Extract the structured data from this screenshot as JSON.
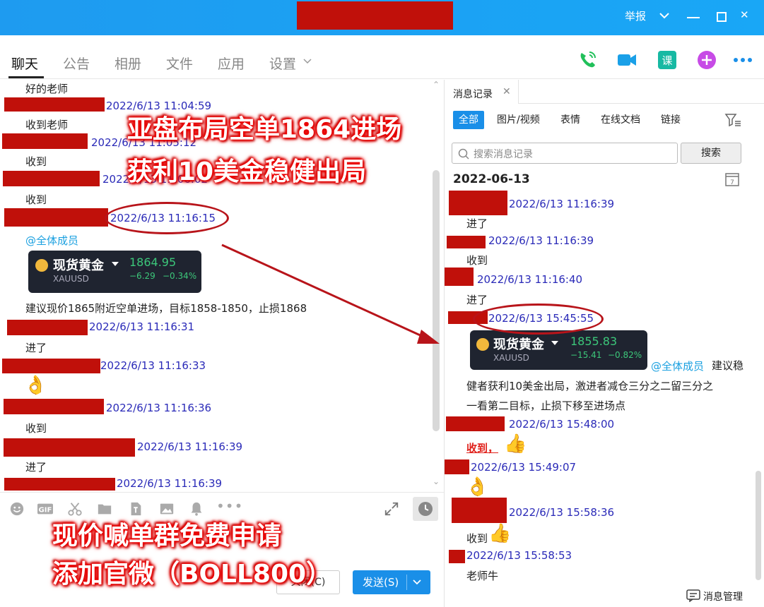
{
  "titlebar": {
    "report": "举报",
    "close": "✕"
  },
  "nav": {
    "tabs": [
      "聊天",
      "公告",
      "相册",
      "文件",
      "应用",
      "设置"
    ]
  },
  "left": {
    "messages": [
      {
        "text": "好的老师"
      },
      {
        "ts": "2022/6/13 11:04:59",
        "text": "收到老师"
      },
      {
        "ts": "2022/6/13 11:05:12",
        "text": "收到"
      },
      {
        "ts": "2022/6/13 11:06:02",
        "text": "收到"
      },
      {
        "ts": "2022/6/13 11:16:15",
        "mention": "@全体成员"
      },
      {
        "advice": "建议现价1865附近空单进场，目标1858-1850，止损1868"
      },
      {
        "ts": "2022/6/13 11:16:31",
        "text": "进了"
      },
      {
        "ts": "2022/6/13 11:16:33",
        "text": ""
      },
      {
        "ts": "2022/6/13 11:16:36",
        "text": "收到"
      },
      {
        "ts": "2022/6/13 11:16:39",
        "text": "进了"
      },
      {
        "ts": "2022/6/13 11:16:39"
      }
    ],
    "stock": {
      "name": "现货黄金",
      "code": "XAUUSD",
      "price": "1864.95",
      "chg": "−6.29",
      "pct": "−0.34%"
    },
    "close_label": "关闭(C)",
    "send_label": "发送(S)"
  },
  "right": {
    "tab": "消息记录",
    "filters": [
      "全部",
      "图片/视频",
      "表情",
      "在线文档",
      "链接"
    ],
    "search_placeholder": "搜索消息记录",
    "search_button": "搜索",
    "date": "2022-06-13",
    "messages": [
      {
        "ts": "2022/6/13 11:16:39",
        "text": "进了"
      },
      {
        "ts": "2022/6/13 11:16:39",
        "text": "收到"
      },
      {
        "ts": "2022/6/13 11:16:40",
        "text": "进了"
      },
      {
        "ts": "2022/6/13 15:45:55",
        "mention": "@全体成员",
        "text1": "建议稳",
        "text2": "健者获利10美金出局，激进者减仓三分之二留三分之",
        "text3": "一看第二目标，止损下移至进场点"
      },
      {
        "ts": "2022/6/13 15:48:00",
        "text": "收到，"
      },
      {
        "ts": "2022/6/13 15:49:07"
      },
      {
        "ts": "2022/6/13 15:58:36",
        "text": "收到"
      },
      {
        "ts": "2022/6/13 15:58:53",
        "text": "老师牛"
      }
    ],
    "stock": {
      "name": "现货黄金",
      "code": "XAUUSD",
      "price": "1855.83",
      "chg": "−15.41",
      "pct": "−0.82%"
    },
    "footer": "消息管理"
  },
  "overlay": {
    "line1": "亚盘布局空单1864进场",
    "line2": "获利10美金稳健出局",
    "line3": "现价喊单群免费申请",
    "line4": "添加官微（BOLL800）"
  },
  "colors": {
    "brand": "#1a8fe8",
    "redact": "#c0100a",
    "timestamp": "#2a2ab8",
    "mention": "#1aa0e0",
    "gain": "#3cc77a"
  }
}
